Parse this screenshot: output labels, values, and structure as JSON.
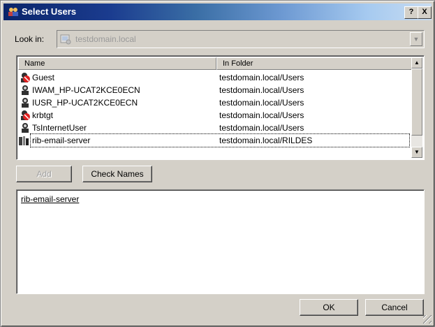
{
  "window": {
    "title": "Select Users"
  },
  "title_buttons": {
    "help": "?",
    "close": "X"
  },
  "look_in": {
    "label": "Look in:",
    "value": "testdomain.local"
  },
  "columns": {
    "name": "Name",
    "folder": "In Folder"
  },
  "rows": [
    {
      "name": "Guest",
      "folder": "testdomain.local/Users",
      "icon": "user-disabled-icon"
    },
    {
      "name": "IWAM_HP-UCAT2KCE0ECN",
      "folder": "testdomain.local/Users",
      "icon": "user-icon"
    },
    {
      "name": "IUSR_HP-UCAT2KCE0ECN",
      "folder": "testdomain.local/Users",
      "icon": "user-icon"
    },
    {
      "name": "krbtgt",
      "folder": "testdomain.local/Users",
      "icon": "user-disabled-icon"
    },
    {
      "name": "TsInternetUser",
      "folder": "testdomain.local/Users",
      "icon": "user-icon"
    },
    {
      "name": "rib-email-server",
      "folder": "testdomain.local/RILDES",
      "icon": "group-icon"
    }
  ],
  "buttons": {
    "add": "Add",
    "check_names": "Check Names",
    "ok": "OK",
    "cancel": "Cancel"
  },
  "selected_text": "rib-email-server"
}
